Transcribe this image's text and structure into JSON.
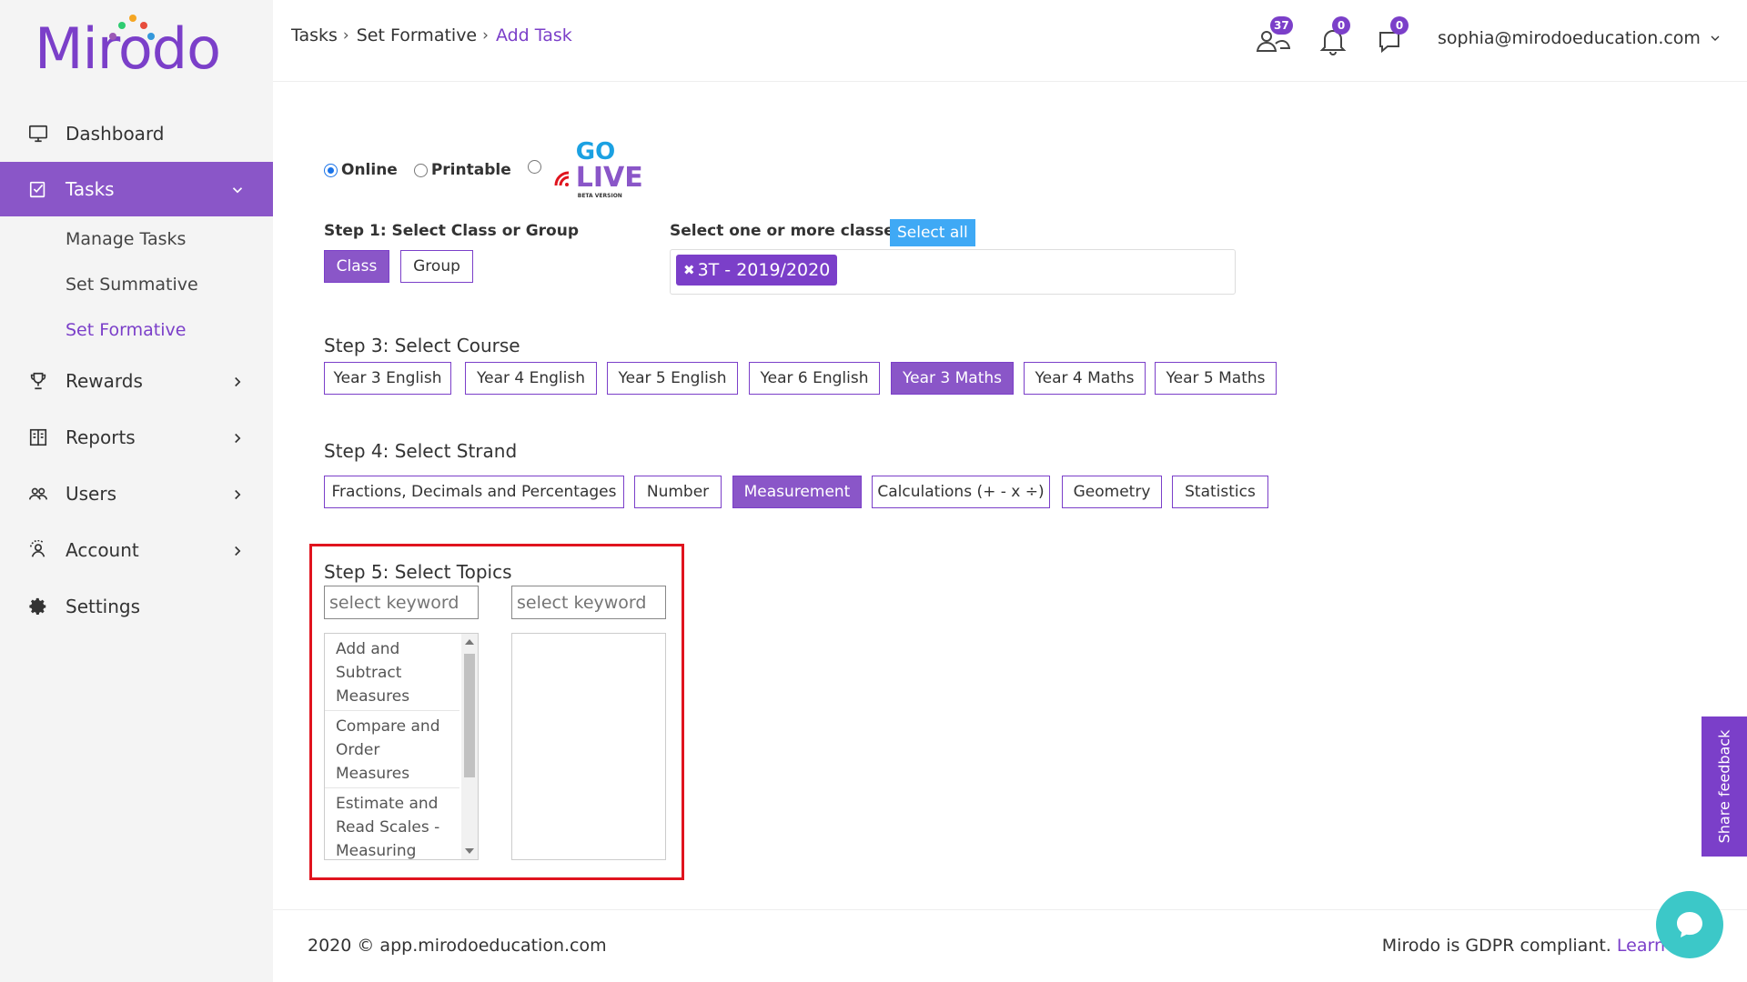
{
  "app": {
    "logo_text": "Mirodo",
    "colors": {
      "brand": "#7b3fc9",
      "active_nav": "#8a56c8",
      "select_all": "#3fa9f5",
      "highlight": "#e0141e",
      "chat": "#3cc8c8"
    }
  },
  "sidebar": {
    "items": [
      {
        "label": "Dashboard",
        "icon": "monitor-icon"
      },
      {
        "label": "Tasks",
        "icon": "tasks-icon",
        "active": true,
        "subitems": [
          {
            "label": "Manage Tasks"
          },
          {
            "label": "Set Summative"
          },
          {
            "label": "Set Formative",
            "active": true
          }
        ]
      },
      {
        "label": "Rewards",
        "icon": "trophy-icon"
      },
      {
        "label": "Reports",
        "icon": "reports-icon"
      },
      {
        "label": "Users",
        "icon": "users-icon"
      },
      {
        "label": "Account",
        "icon": "account-icon"
      },
      {
        "label": "Settings",
        "icon": "gear-icon"
      }
    ]
  },
  "header": {
    "breadcrumb": [
      "Tasks",
      "Set Formative",
      "Add Task"
    ],
    "users_count": "37",
    "notifications_count": "0",
    "messages_count": "0",
    "user_email": "sophia@mirodoeducation.com"
  },
  "mode": {
    "options": [
      "Online",
      "Printable"
    ],
    "selected": "Online",
    "golive_top": "GO",
    "golive_main": "LIVE",
    "golive_sub": "BETA VERSION"
  },
  "step1": {
    "label": "Step 1: Select Class or Group",
    "class_btn": "Class",
    "group_btn": "Group",
    "selected": "Class"
  },
  "classes": {
    "label": "Select one or more classes",
    "select_all": "Select all",
    "selected_chips": [
      "3T - 2019/2020"
    ]
  },
  "step3": {
    "label": "Step 3: Select Course",
    "courses": [
      "Year 3 English",
      "Year 4 English",
      "Year 5 English",
      "Year 6 English",
      "Year 3 Maths",
      "Year 4 Maths",
      "Year 5 Maths"
    ],
    "selected": "Year 3 Maths"
  },
  "step4": {
    "label": "Step 4: Select Strand",
    "strands": [
      "Fractions, Decimals and Percentages",
      "Number",
      "Measurement",
      "Calculations (+ - x ÷)",
      "Geometry",
      "Statistics"
    ],
    "selected": "Measurement"
  },
  "step5": {
    "label": "Step 5: Select Topics",
    "left_placeholder": "select keyword",
    "right_placeholder": "select keyword",
    "topics": [
      "Add and Subtract Measures",
      "Compare and Order Measures",
      "Estimate and Read Scales - Measuring"
    ]
  },
  "footer": {
    "copyright": "2020 © app.mirodoeducation.com",
    "gdpr_text": "Mirodo is GDPR compliant.",
    "gdpr_link": "Learn"
  },
  "feedback": {
    "label": "Share feedback"
  }
}
